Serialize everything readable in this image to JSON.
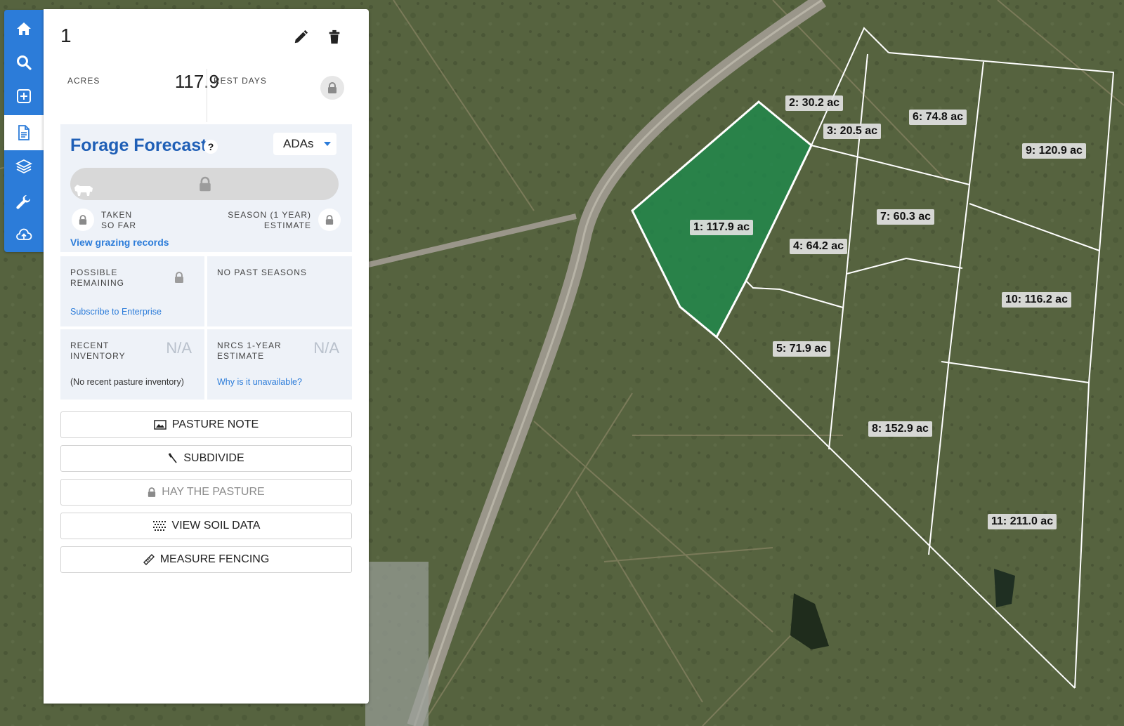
{
  "panel": {
    "title": "1",
    "acres_label": "ACRES",
    "acres_value": "117.9",
    "rest_days_label": "REST DAYS"
  },
  "forage": {
    "title": "Forage Forecast",
    "help": "?",
    "unit": "ADAs",
    "taken_label_1": "TAKEN",
    "taken_label_2": "SO FAR",
    "season_label_1": "SEASON (1 YEAR)",
    "season_label_2": "ESTIMATE",
    "grazing_link": "View grazing records"
  },
  "stats": {
    "possible_label_1": "POSSIBLE",
    "possible_label_2": "REMAINING",
    "subscribe_link": "Subscribe to Enterprise",
    "past_seasons": "NO PAST SEASONS",
    "recent_label_1": "RECENT",
    "recent_label_2": "INVENTORY",
    "recent_value": "N/A",
    "recent_note": "(No recent pasture inventory)",
    "nrcs_label_1": "NRCS 1-YEAR",
    "nrcs_label_2": "ESTIMATE",
    "nrcs_value": "N/A",
    "nrcs_link": "Why is it unavailable?"
  },
  "actions": [
    {
      "label": "PASTURE NOTE",
      "icon": "image-icon",
      "enabled": true
    },
    {
      "label": "SUBDIVIDE",
      "icon": "knife-icon",
      "enabled": true
    },
    {
      "label": "HAY THE PASTURE",
      "icon": "lock-icon",
      "enabled": false
    },
    {
      "label": "VIEW SOIL DATA",
      "icon": "dot-grid-icon",
      "enabled": true
    },
    {
      "label": "MEASURE FENCING",
      "icon": "ruler-icon",
      "enabled": true
    }
  ],
  "toolbar": [
    {
      "icon": "home-icon"
    },
    {
      "icon": "search-icon"
    },
    {
      "icon": "add-square-icon"
    },
    {
      "icon": "document-icon",
      "active": true
    },
    {
      "icon": "layers-icon"
    },
    {
      "icon": "wrench-icon"
    },
    {
      "icon": "cloud-upload-icon"
    }
  ],
  "map": {
    "pastures": [
      {
        "label": "1: 117.9 ac",
        "selected": true
      },
      {
        "label": "2: 30.2 ac"
      },
      {
        "label": "3: 20.5 ac"
      },
      {
        "label": "4: 64.2 ac"
      },
      {
        "label": "5: 71.9 ac"
      },
      {
        "label": "6: 74.8 ac"
      },
      {
        "label": "7: 60.3 ac"
      },
      {
        "label": "8: 152.9 ac"
      },
      {
        "label": "9: 120.9 ac"
      },
      {
        "label": "10: 116.2 ac"
      },
      {
        "label": "11: 211.0 ac"
      }
    ],
    "selected_fill": "#1e8a4c",
    "boundary_color": "#ffffff"
  },
  "colors": {
    "accent": "#2c7cd9",
    "title_blue": "#1f5fb6"
  }
}
